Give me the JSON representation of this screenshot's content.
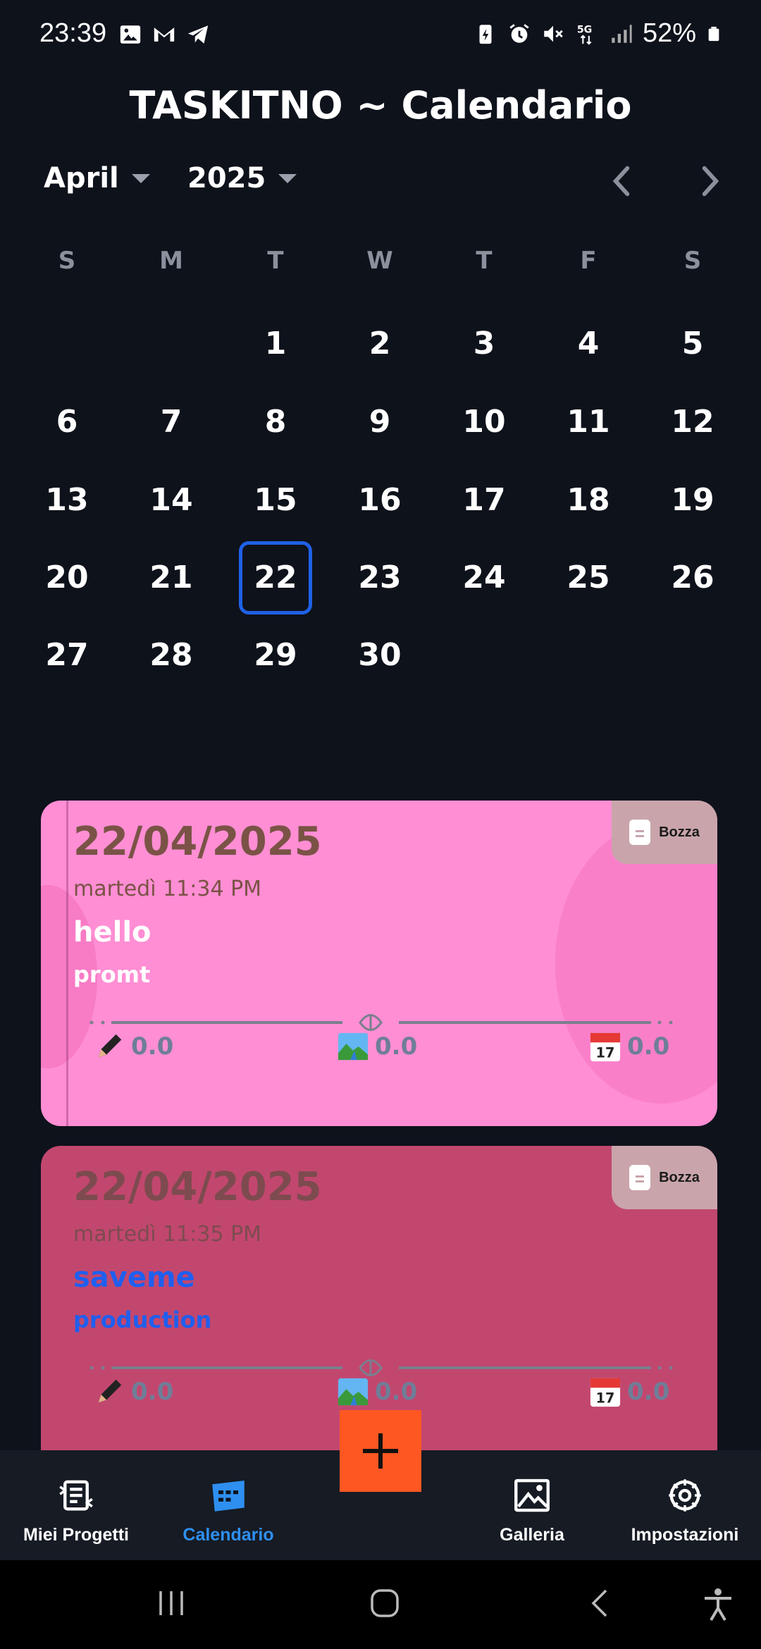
{
  "status_bar": {
    "time": "23:39",
    "battery": "52%",
    "network": "5G",
    "left_icons": [
      "image-icon",
      "gmail-icon",
      "telegram-icon"
    ],
    "right_icons": [
      "battery-saver-icon",
      "alarm-icon",
      "mute-icon",
      "5g-icon",
      "signal-icon",
      "battery-icon"
    ]
  },
  "header": {
    "title": "TASKITNO ~ Calendario"
  },
  "calendar": {
    "month": "April",
    "year": "2025",
    "weekdays": [
      "S",
      "M",
      "T",
      "W",
      "T",
      "F",
      "S"
    ],
    "weeks": [
      [
        "",
        "",
        "1",
        "2",
        "3",
        "4",
        "5"
      ],
      [
        "6",
        "7",
        "8",
        "9",
        "10",
        "11",
        "12"
      ],
      [
        "13",
        "14",
        "15",
        "16",
        "17",
        "18",
        "19"
      ],
      [
        "20",
        "21",
        "22",
        "23",
        "24",
        "25",
        "26"
      ],
      [
        "27",
        "28",
        "29",
        "30",
        "",
        "",
        ""
      ]
    ],
    "selected_day": "22"
  },
  "cards": [
    {
      "date": "22/04/2025",
      "time": "martedì 11:34 PM",
      "title": "hello",
      "subtitle": "promt",
      "badge": "Bozza",
      "stats": {
        "edit": "0.0",
        "image": "0.0",
        "calendar": "0.0"
      },
      "background": "#ff8ed4"
    },
    {
      "date": "22/04/2025",
      "time": "martedì 11:35 PM",
      "title": "saveme",
      "subtitle": "production",
      "badge": "Bozza",
      "stats": {
        "edit": "0.0",
        "image": "0.0",
        "calendar": "0.0"
      },
      "background": "#c2476f"
    }
  ],
  "bottom_nav": {
    "items": [
      {
        "label": "Miei Progetti",
        "icon": "projects-icon"
      },
      {
        "label": "Calendario",
        "icon": "calendar-icon",
        "active": true
      },
      {
        "label": "Galleria",
        "icon": "gallery-icon"
      },
      {
        "label": "Impostazioni",
        "icon": "settings-icon"
      }
    ]
  },
  "colors": {
    "background": "#0e121b",
    "accent": "#1f61e6",
    "active_nav": "#2e8ff0",
    "fab": "#ff5722"
  }
}
